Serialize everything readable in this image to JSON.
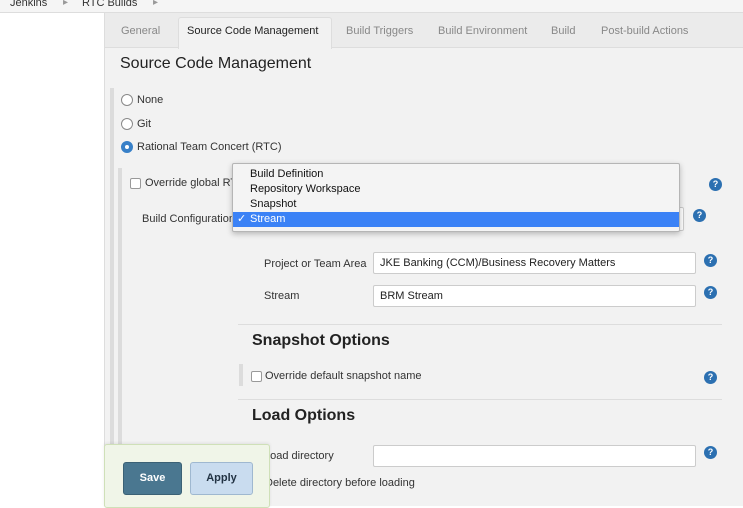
{
  "breadcrumb": {
    "items": [
      "Jenkins",
      "RTC Builds"
    ]
  },
  "tabs": [
    {
      "label": "General"
    },
    {
      "label": "Source Code Management"
    },
    {
      "label": "Build Triggers"
    },
    {
      "label": "Build Environment"
    },
    {
      "label": "Build"
    },
    {
      "label": "Post-build Actions"
    }
  ],
  "active_tab": "Source Code Management",
  "section_title": "Source Code Management",
  "scm_options": [
    {
      "label": "None",
      "selected": false
    },
    {
      "label": "Git",
      "selected": false
    },
    {
      "label": "Rational Team Concert (RTC)",
      "selected": true
    }
  ],
  "rtc": {
    "override_global_label": "Override global RT",
    "build_configuration_label": "Build Configuration",
    "dropdown_options": [
      "Build Definition",
      "Repository Workspace",
      "Snapshot",
      "Stream"
    ],
    "dropdown_selected": "Stream",
    "check_mark": "✓",
    "project_area_label": "Project or Team Area",
    "project_area_value": "JKE Banking (CCM)/Business Recovery Matters",
    "stream_label": "Stream",
    "stream_value": "BRM Stream"
  },
  "snapshot_options": {
    "title": "Snapshot Options",
    "override_name_label": "Override default snapshot name"
  },
  "load_options": {
    "title": "Load Options",
    "load_directory_label": "Load directory",
    "load_directory_value": "",
    "delete_directory_label": "Delete directory before loading"
  },
  "buttons": {
    "save": "Save",
    "apply": "Apply"
  },
  "help_glyph": "?",
  "colors": {
    "primary_button": "#4a7790",
    "apply_button": "#c9dcef",
    "selection": "#3b82f6",
    "help_icon": "#2c70b1"
  }
}
